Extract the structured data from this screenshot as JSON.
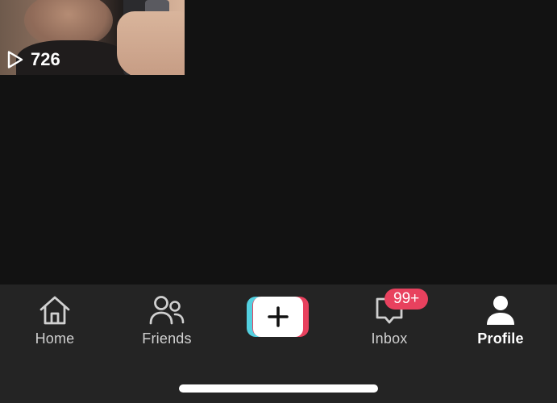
{
  "video": {
    "views": "726",
    "play_icon": "play-outline-icon"
  },
  "tabbar": {
    "tabs": [
      {
        "label": "Home",
        "icon": "home-icon",
        "active": false
      },
      {
        "label": "Friends",
        "icon": "friends-icon",
        "active": false
      },
      {
        "label": "",
        "icon": "create-plus-icon",
        "active": false
      },
      {
        "label": "Inbox",
        "icon": "inbox-icon",
        "active": false,
        "badge": "99+"
      },
      {
        "label": "Profile",
        "icon": "profile-icon",
        "active": true
      }
    ]
  },
  "colors": {
    "background": "#121212",
    "tabbar": "#242424",
    "badge": "#e8415e",
    "create_cyan": "#53d0e0",
    "create_red": "#e8415e"
  }
}
